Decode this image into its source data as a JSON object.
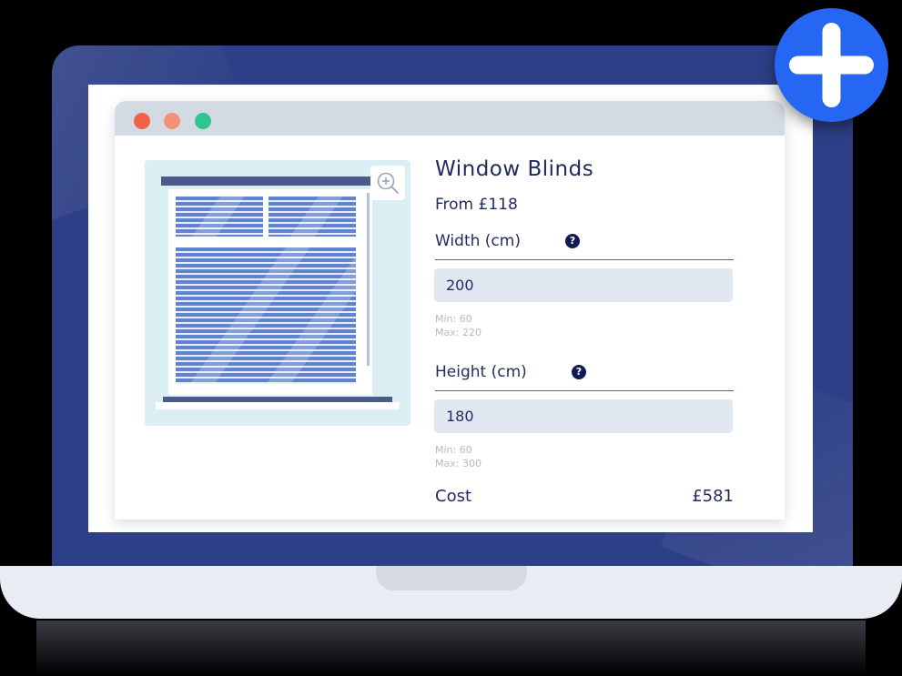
{
  "product": {
    "title": "Window Blinds",
    "price_from": "From £118"
  },
  "width": {
    "label": "Width (cm)",
    "value": "200",
    "min": "Min: 60",
    "max": "Max: 220"
  },
  "height": {
    "label": "Height (cm)",
    "value": "180",
    "min": "Min: 60",
    "max": "Max: 300"
  },
  "cost": {
    "label": "Cost",
    "value": "£581"
  },
  "help_glyph": "?",
  "icons": {
    "zoom": "zoom-in-icon",
    "help": "question-circle-icon",
    "add": "plus-icon"
  },
  "colors": {
    "laptop_lid": "#2d3f86",
    "accent_blue": "#2566f2",
    "navy_text": "#1f2b5e",
    "input_bg": "#e1e8f2",
    "window_red": "#f06347",
    "window_orange": "#f19278",
    "window_green": "#30c58f"
  }
}
